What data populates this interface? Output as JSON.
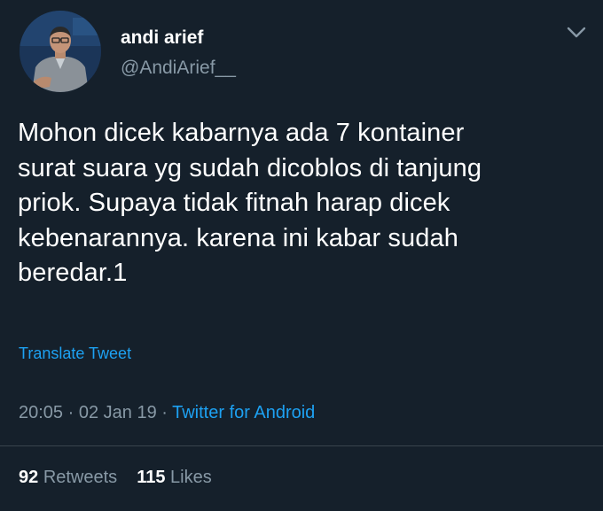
{
  "user": {
    "name": "andi arief",
    "handle": "@AndiArief__"
  },
  "tweet": {
    "lines": [
      "Mohon dicek kabarnya ada 7 kontainer",
      "surat suara yg sudah dicoblos di tanjung",
      "priok. Supaya tidak fitnah harap dicek",
      "kebenarannya. karena ini kabar sudah",
      "beredar.1"
    ],
    "translate_label": "Translate Tweet"
  },
  "meta": {
    "time": "20:05",
    "date": "02 Jan 19",
    "source": "Twitter for Android",
    "separator": " · "
  },
  "stats": {
    "retweets_count": "92",
    "retweets_label": "Retweets",
    "likes_count": "115",
    "likes_label": "Likes"
  },
  "icons": {
    "menu": "chevron-down-icon"
  },
  "colors": {
    "background": "#15202b",
    "link": "#1da1f2",
    "secondary_text": "#8899a6",
    "divider": "#38444d"
  }
}
